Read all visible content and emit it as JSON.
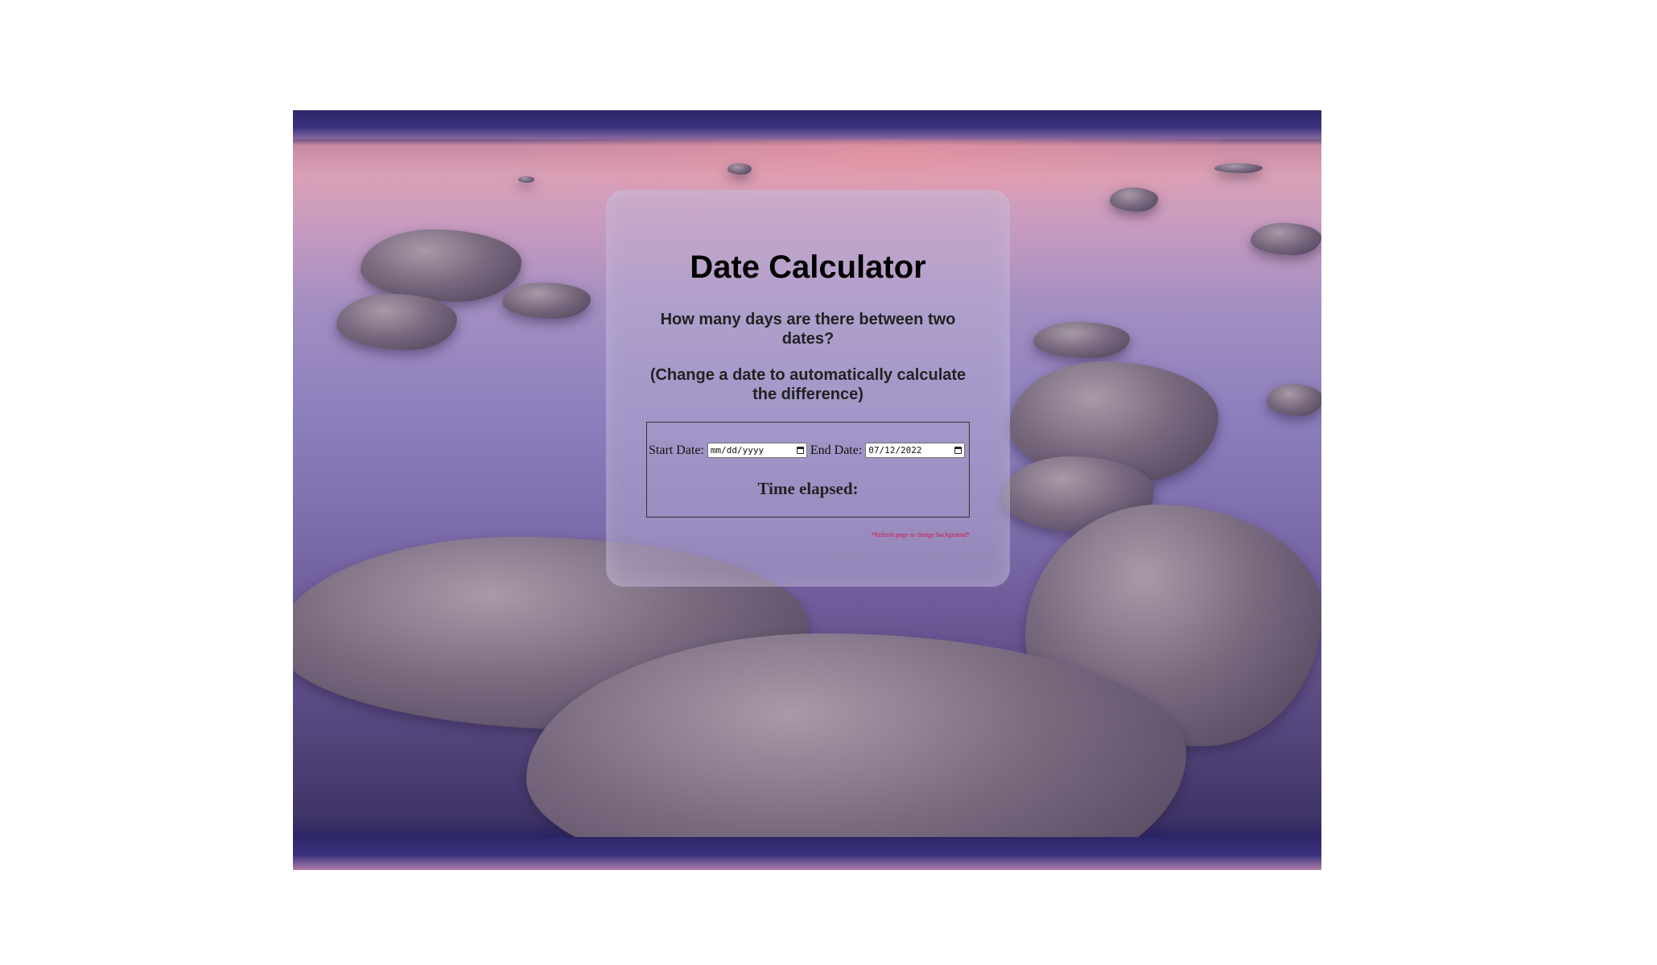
{
  "page": {
    "background_description_colors": {
      "accent_sky": "#d9a0b6",
      "water": "#8c7fbd",
      "band": "#2d2668"
    }
  },
  "card": {
    "title": "Date Calculator",
    "subtitle": "How many days are there between two dates?",
    "instruction": "(Change a date to automatically calculate the difference)",
    "start_label": "Start Date:",
    "start_value": "mm/dd/yyyy",
    "end_label": "End Date:",
    "end_value": "07/12/2022",
    "result_label": "Time elapsed:",
    "refresh_note": "*Refresh page to change background*"
  },
  "icons": {
    "calendar": "calendar-icon"
  },
  "colors": {
    "title": "#000000",
    "note": "#d0154a"
  }
}
